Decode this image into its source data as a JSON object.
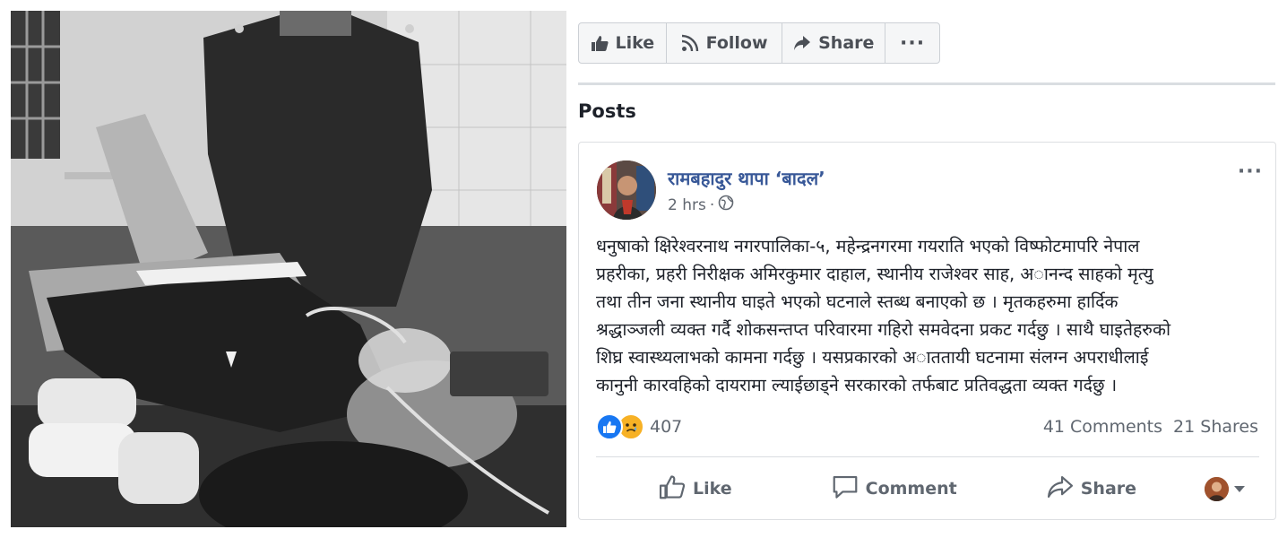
{
  "page_actions": {
    "like_label": "Like",
    "follow_label": "Follow",
    "share_label": "Share",
    "more_label": "···"
  },
  "posts_heading": "Posts",
  "post": {
    "author": "रामबहादुर थापा ‘बादल’",
    "time": "2 hrs",
    "separator": "·",
    "audience_icon": "globe-icon",
    "menu_label": "···",
    "body": "धनुषाको क्षिरेश्वरनाथ नगरपालिका-५, महेन्द्रनगरमा गयराति भएको विष्फोटमापरि नेपाल\nप्रहरीका, प्रहरी निरीक्षक अमिरकुमार दाहाल, स्थानीय राजेश्वर साह, अानन्द साहको मृत्यु\nतथा तीन जना स्थानीय घाइते भएको घटनाले स्तब्ध बनाएको छ । मृतकहरुमा हार्दिक\nश्रद्धाञ्जली व्यक्त गर्दै शोकसन्तप्त परिवारमा गहिरो समवेदना प्रकट गर्दछु । साथै घाइतेहरुको\nशिघ्र स्वास्थ्यलाभको कामना गर्दछु । यसप्रकारको अाततायी घटनामा संलग्न अपराधीलाई\nकानुनी कारवहिको दायरामा ल्याईछाड्ने सरकारको तर्फबाट प्रतिवद्धता व्यक्त गर्दछु ।",
    "reaction_count": "407",
    "comments": "41 Comments",
    "shares": "21 Shares",
    "actions": {
      "like_label": "Like",
      "comment_label": "Comment",
      "share_label": "Share"
    }
  },
  "colors": {
    "link": "#385898",
    "like_blue": "#1877f2",
    "sad_yellow": "#f7b125",
    "muted": "#606770"
  }
}
